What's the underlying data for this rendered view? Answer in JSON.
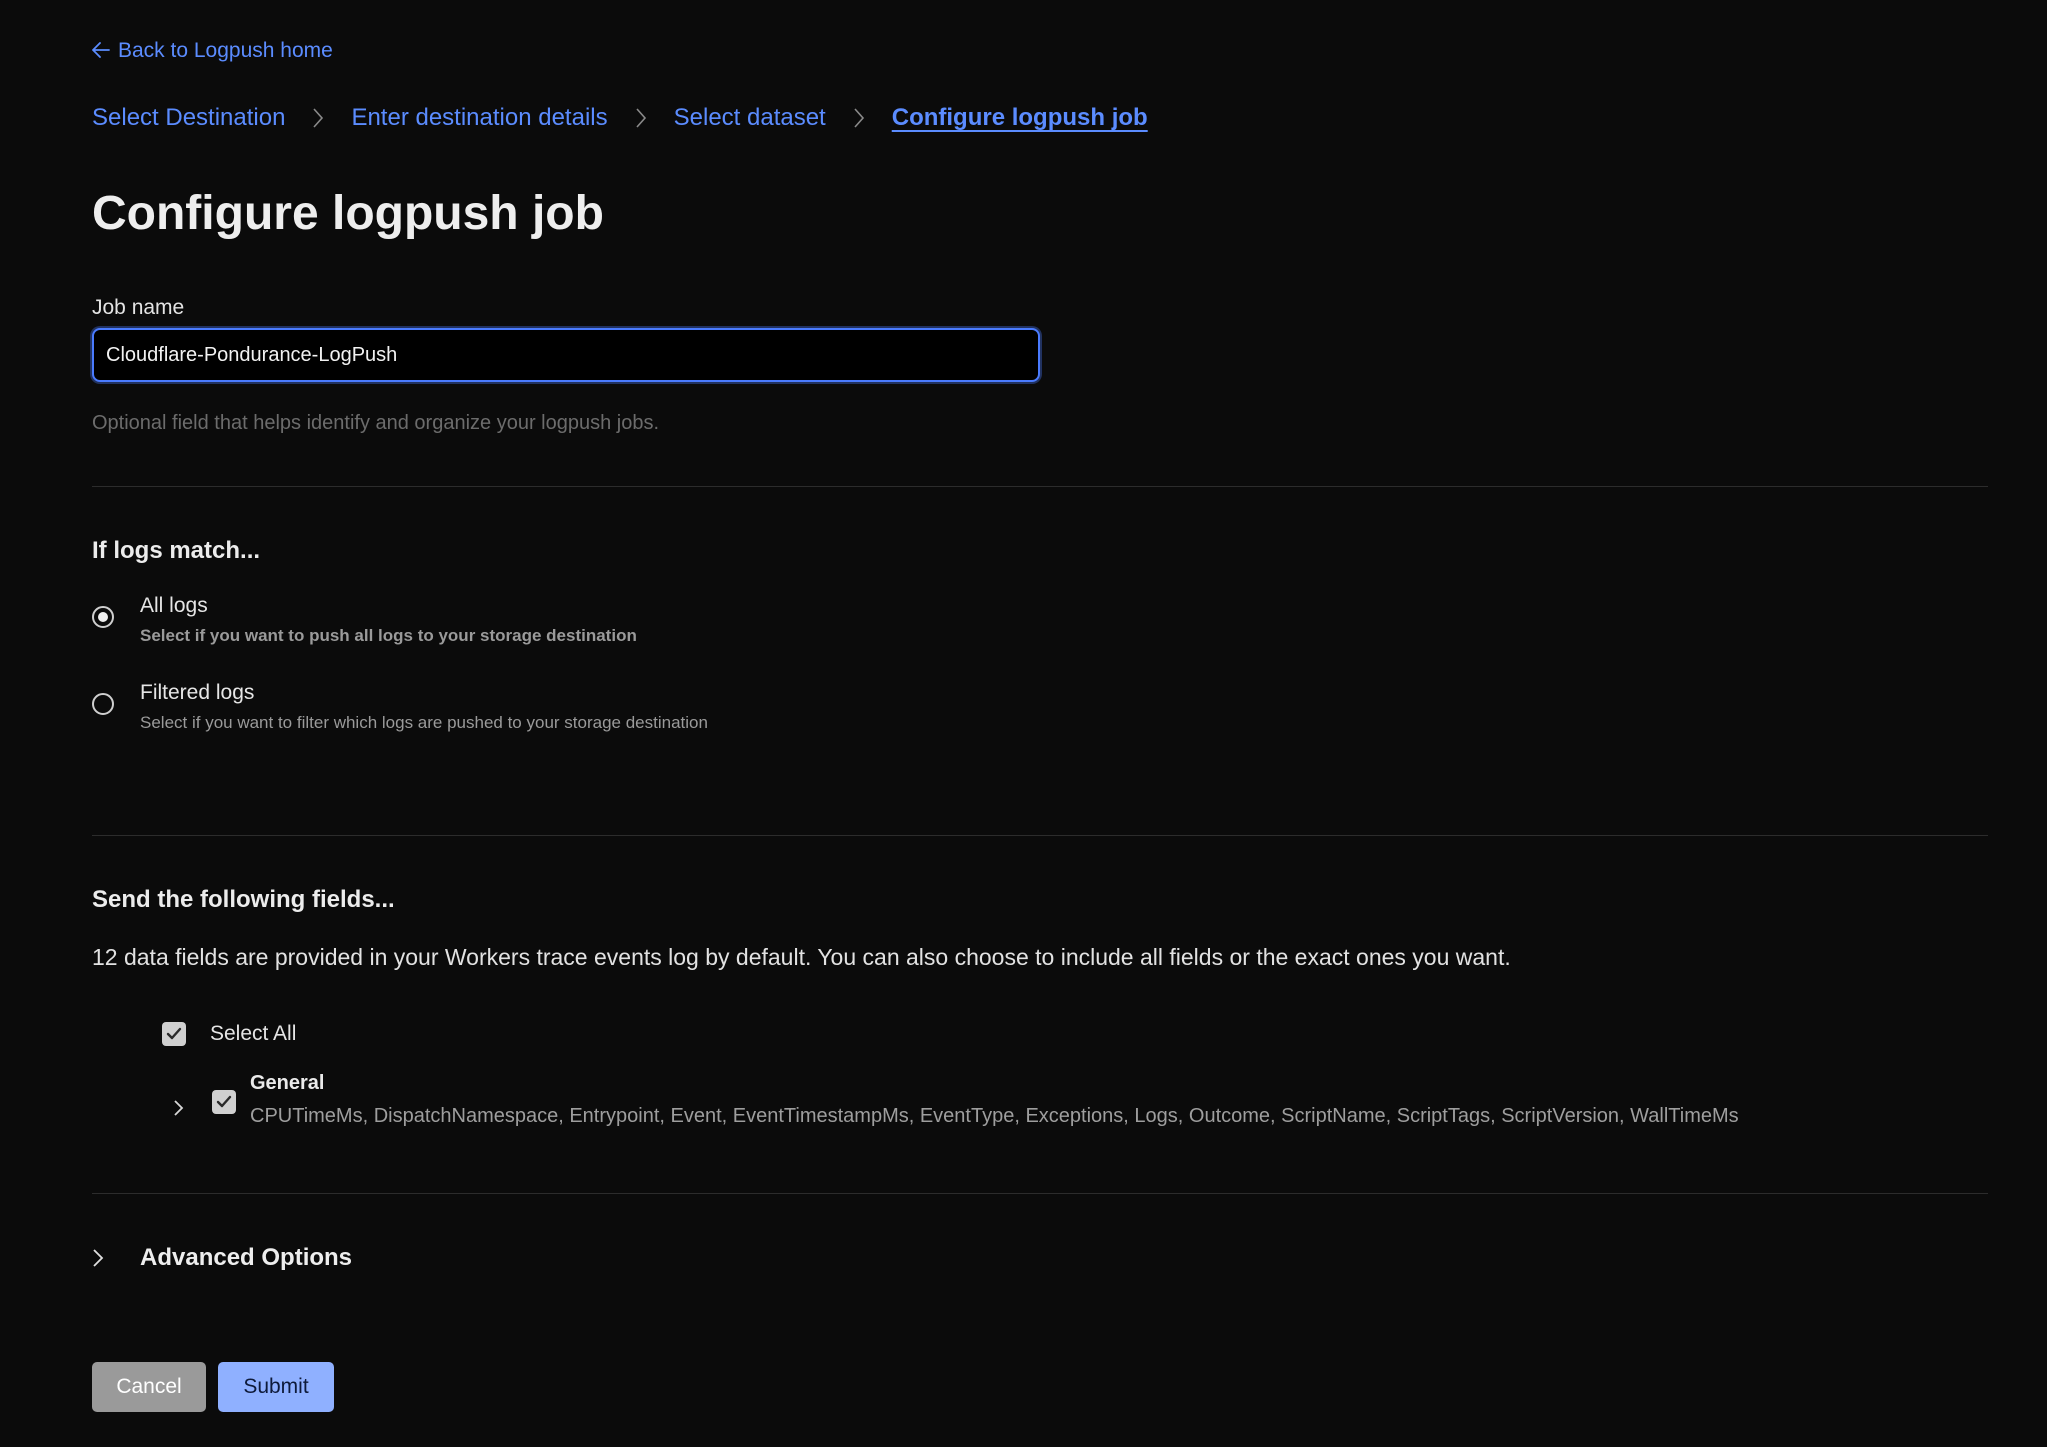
{
  "nav": {
    "back_label": "Back to Logpush home"
  },
  "breadcrumb": {
    "steps": [
      {
        "label": "Select Destination"
      },
      {
        "label": "Enter destination details"
      },
      {
        "label": "Select dataset"
      },
      {
        "label": "Configure logpush job"
      }
    ],
    "active_index": 3
  },
  "page": {
    "title": "Configure logpush job"
  },
  "job_name": {
    "label": "Job name",
    "value": "Cloudflare-Pondurance-LogPush",
    "hint": "Optional field that helps identify and organize your logpush jobs."
  },
  "filter": {
    "heading": "If logs match...",
    "options": [
      {
        "title": "All logs",
        "description": "Select if you want to push all logs to your storage destination",
        "selected": true
      },
      {
        "title": "Filtered logs",
        "description": "Select if you want to filter which logs are pushed to your storage destination",
        "selected": false
      }
    ]
  },
  "fields": {
    "heading": "Send the following fields...",
    "description": "12 data fields are provided in your Workers trace events log by default. You can also choose to include all fields or the exact ones you want.",
    "select_all_label": "Select All",
    "select_all_checked": true,
    "groups": [
      {
        "title": "General",
        "checked": true,
        "expanded": false,
        "fields_text": "CPUTimeMs, DispatchNamespace, Entrypoint, Event, EventTimestampMs, EventType, Exceptions, Logs, Outcome, ScriptName, ScriptTags, ScriptVersion, WallTimeMs"
      }
    ]
  },
  "advanced": {
    "label": "Advanced Options",
    "expanded": false
  },
  "actions": {
    "cancel_label": "Cancel",
    "submit_label": "Submit"
  },
  "colors": {
    "background": "#0b0b0b",
    "link": "#5b8cff",
    "focus_border": "#4a7bff",
    "submit_bg": "#8fb0ff",
    "cancel_bg": "#9a9a9a"
  },
  "icons": {
    "back": "arrow-left-icon",
    "breadcrumb_separator": "chevron-right-icon",
    "expand": "chevron-right-icon",
    "checkbox": "check-icon"
  }
}
